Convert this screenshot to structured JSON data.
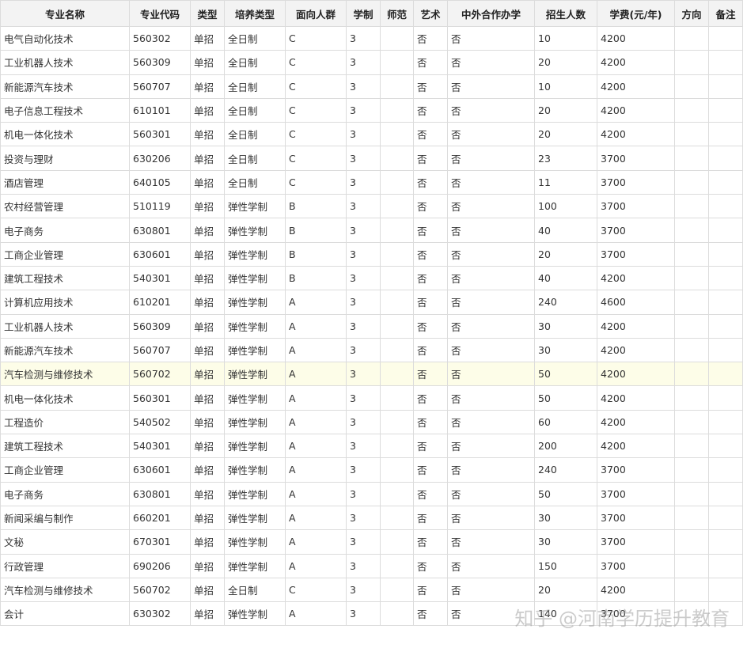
{
  "table": {
    "headers": [
      "专业名称",
      "专业代码",
      "类型",
      "培养类型",
      "面向人群",
      "学制",
      "师范",
      "艺术",
      "中外合作办学",
      "招生人数",
      "学费(元/年)",
      "方向",
      "备注"
    ],
    "rows": [
      [
        "电气自动化技术",
        "560302",
        "单招",
        "全日制",
        "C",
        "3",
        "",
        "否",
        "否",
        "10",
        "4200",
        "",
        ""
      ],
      [
        "工业机器人技术",
        "560309",
        "单招",
        "全日制",
        "C",
        "3",
        "",
        "否",
        "否",
        "20",
        "4200",
        "",
        ""
      ],
      [
        "新能源汽车技术",
        "560707",
        "单招",
        "全日制",
        "C",
        "3",
        "",
        "否",
        "否",
        "10",
        "4200",
        "",
        ""
      ],
      [
        "电子信息工程技术",
        "610101",
        "单招",
        "全日制",
        "C",
        "3",
        "",
        "否",
        "否",
        "20",
        "4200",
        "",
        ""
      ],
      [
        "机电一体化技术",
        "560301",
        "单招",
        "全日制",
        "C",
        "3",
        "",
        "否",
        "否",
        "20",
        "4200",
        "",
        ""
      ],
      [
        "投资与理财",
        "630206",
        "单招",
        "全日制",
        "C",
        "3",
        "",
        "否",
        "否",
        "23",
        "3700",
        "",
        ""
      ],
      [
        "酒店管理",
        "640105",
        "单招",
        "全日制",
        "C",
        "3",
        "",
        "否",
        "否",
        "11",
        "3700",
        "",
        ""
      ],
      [
        "农村经营管理",
        "510119",
        "单招",
        "弹性学制",
        "B",
        "3",
        "",
        "否",
        "否",
        "100",
        "3700",
        "",
        ""
      ],
      [
        "电子商务",
        "630801",
        "单招",
        "弹性学制",
        "B",
        "3",
        "",
        "否",
        "否",
        "40",
        "3700",
        "",
        ""
      ],
      [
        "工商企业管理",
        "630601",
        "单招",
        "弹性学制",
        "B",
        "3",
        "",
        "否",
        "否",
        "20",
        "3700",
        "",
        ""
      ],
      [
        "建筑工程技术",
        "540301",
        "单招",
        "弹性学制",
        "B",
        "3",
        "",
        "否",
        "否",
        "40",
        "4200",
        "",
        ""
      ],
      [
        "计算机应用技术",
        "610201",
        "单招",
        "弹性学制",
        "A",
        "3",
        "",
        "否",
        "否",
        "240",
        "4600",
        "",
        ""
      ],
      [
        "工业机器人技术",
        "560309",
        "单招",
        "弹性学制",
        "A",
        "3",
        "",
        "否",
        "否",
        "30",
        "4200",
        "",
        ""
      ],
      [
        "新能源汽车技术",
        "560707",
        "单招",
        "弹性学制",
        "A",
        "3",
        "",
        "否",
        "否",
        "30",
        "4200",
        "",
        ""
      ],
      [
        "汽车检测与维修技术",
        "560702",
        "单招",
        "弹性学制",
        "A",
        "3",
        "",
        "否",
        "否",
        "50",
        "4200",
        "",
        ""
      ],
      [
        "机电一体化技术",
        "560301",
        "单招",
        "弹性学制",
        "A",
        "3",
        "",
        "否",
        "否",
        "50",
        "4200",
        "",
        ""
      ],
      [
        "工程造价",
        "540502",
        "单招",
        "弹性学制",
        "A",
        "3",
        "",
        "否",
        "否",
        "60",
        "4200",
        "",
        ""
      ],
      [
        "建筑工程技术",
        "540301",
        "单招",
        "弹性学制",
        "A",
        "3",
        "",
        "否",
        "否",
        "200",
        "4200",
        "",
        ""
      ],
      [
        "工商企业管理",
        "630601",
        "单招",
        "弹性学制",
        "A",
        "3",
        "",
        "否",
        "否",
        "240",
        "3700",
        "",
        ""
      ],
      [
        "电子商务",
        "630801",
        "单招",
        "弹性学制",
        "A",
        "3",
        "",
        "否",
        "否",
        "50",
        "3700",
        "",
        ""
      ],
      [
        "新闻采编与制作",
        "660201",
        "单招",
        "弹性学制",
        "A",
        "3",
        "",
        "否",
        "否",
        "30",
        "3700",
        "",
        ""
      ],
      [
        "文秘",
        "670301",
        "单招",
        "弹性学制",
        "A",
        "3",
        "",
        "否",
        "否",
        "30",
        "3700",
        "",
        ""
      ],
      [
        "行政管理",
        "690206",
        "单招",
        "弹性学制",
        "A",
        "3",
        "",
        "否",
        "否",
        "150",
        "3700",
        "",
        ""
      ],
      [
        "汽车检测与维修技术",
        "560702",
        "单招",
        "全日制",
        "C",
        "3",
        "",
        "否",
        "否",
        "20",
        "4200",
        "",
        ""
      ],
      [
        "会计",
        "630302",
        "单招",
        "弹性学制",
        "A",
        "3",
        "",
        "否",
        "否",
        "140",
        "3700",
        "",
        ""
      ]
    ],
    "highlighted_row": 14
  },
  "watermark": {
    "text": "知乎 @河南学历提升教育"
  }
}
